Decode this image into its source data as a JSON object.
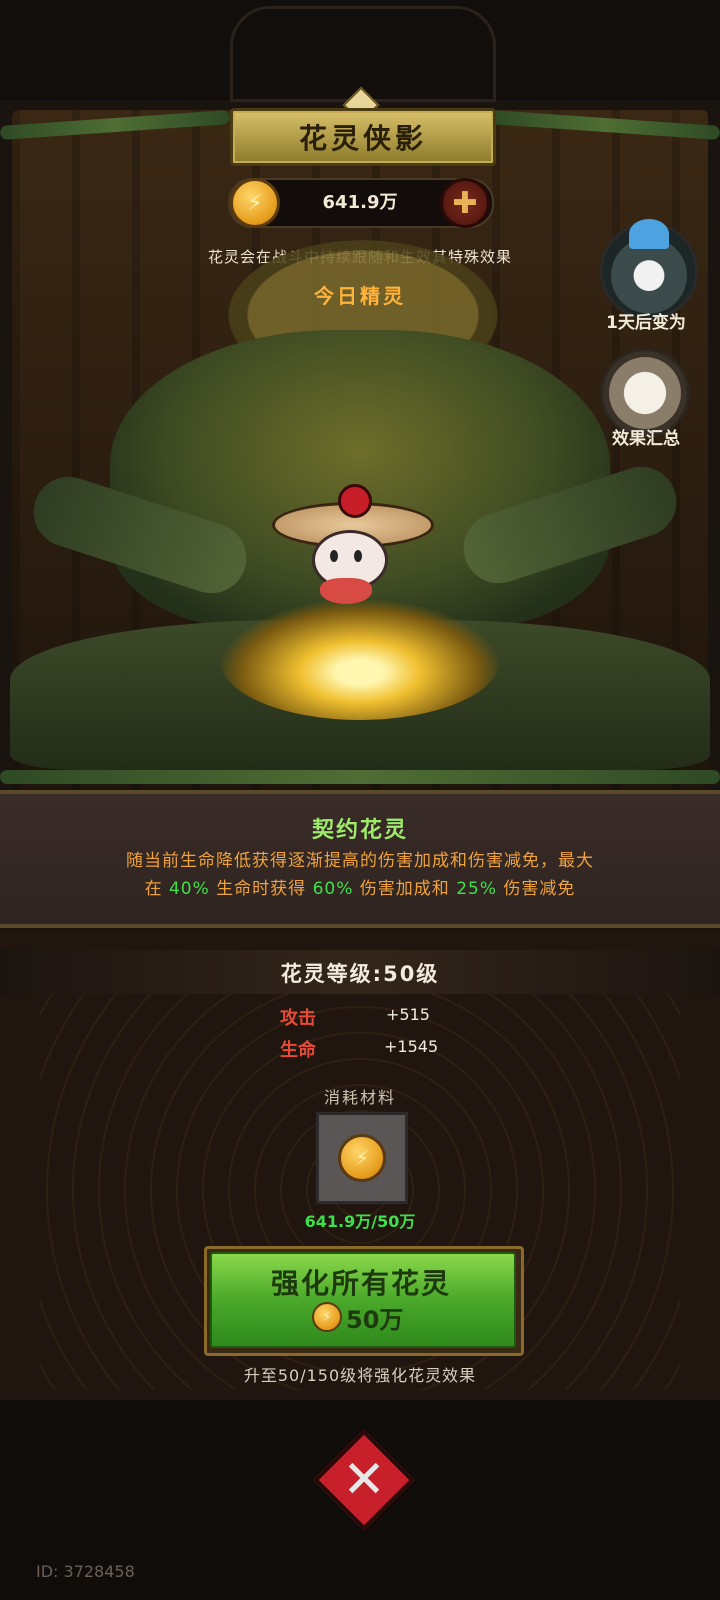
{
  "header": {
    "title": "花灵侠影"
  },
  "currency": {
    "value": "641.9万",
    "coin_icon": "coin-icon",
    "add_icon": "plus-icon"
  },
  "info": {
    "description": "花灵会在战斗中持续跟随和生效其特殊效果",
    "today_label": "今日精灵"
  },
  "side_buttons": {
    "next_label": "1天后变为",
    "summary_label": "效果汇总"
  },
  "skill": {
    "name": "契约花灵",
    "desc_line1": "随当前生命降低获得逐渐提高的伤害加成和伤害减免，最大",
    "desc_line2_a": "在 ",
    "desc_line2_hp": "40%",
    "desc_line2_b": " 生命时获得 ",
    "desc_line2_dmg": "60%",
    "desc_line2_c": " 伤害加成和 ",
    "desc_line2_red": "25%",
    "desc_line2_d": " 伤害减免"
  },
  "level": {
    "label": "花灵等级:50级",
    "stats": [
      {
        "name": "攻击",
        "value": "+515"
      },
      {
        "name": "生命",
        "value": "+1545"
      }
    ]
  },
  "material": {
    "label": "消耗材料",
    "count": "641.9万/50万"
  },
  "upgrade": {
    "label": "强化所有花灵",
    "cost": "50万",
    "hint": "升至50/150级将强化花灵效果"
  },
  "footer": {
    "id": "ID: 3728458"
  },
  "colors": {
    "accent_orange": "#f0a23c",
    "highlight_green": "#3ee04a",
    "button_green": "#4aa82a",
    "stat_red": "#e84a3a"
  }
}
